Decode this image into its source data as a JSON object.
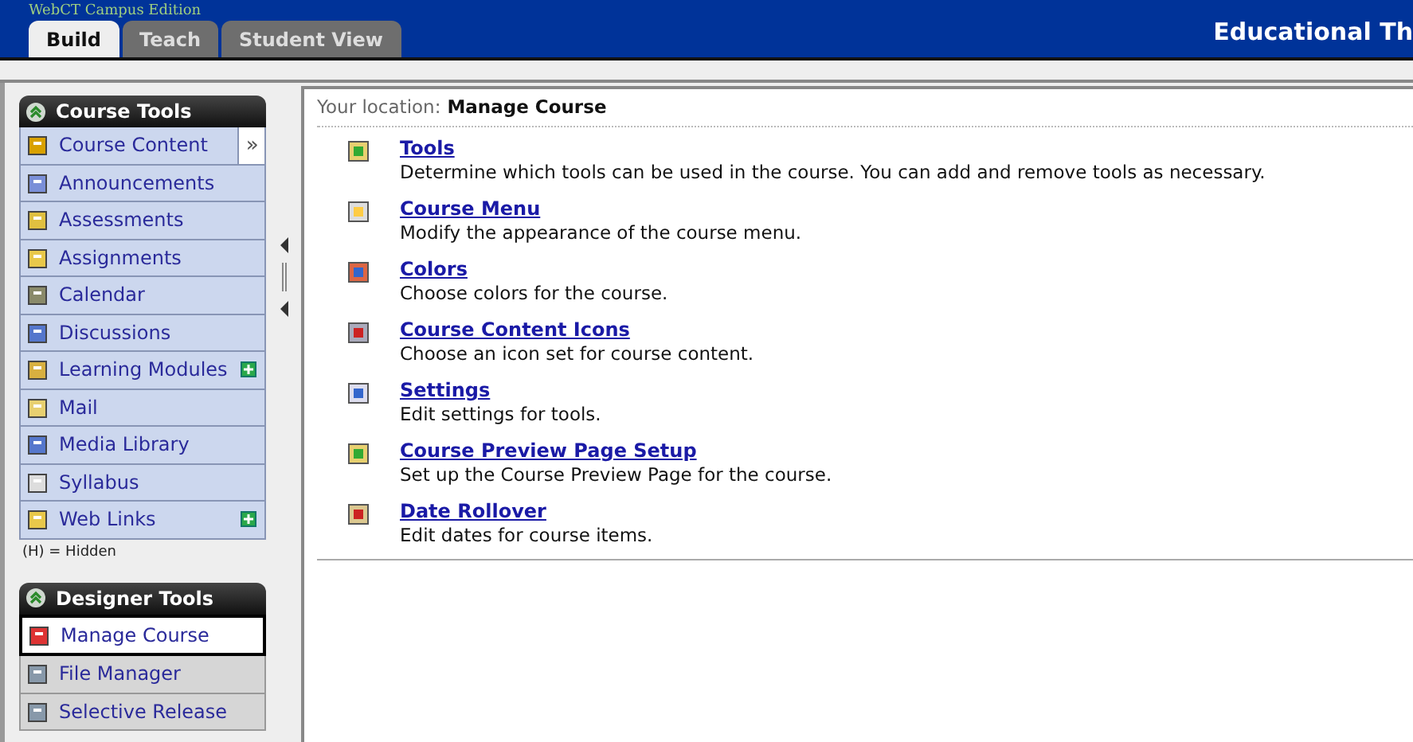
{
  "header": {
    "logo": "WebCT Campus Edition",
    "title": "Educational Th"
  },
  "tabs": [
    {
      "label": "Build",
      "selected": true
    },
    {
      "label": "Teach",
      "selected": false
    },
    {
      "label": "Student View",
      "selected": false
    }
  ],
  "sidebar": {
    "sections": [
      {
        "title": "Course Tools",
        "items": [
          {
            "label": "Course Content",
            "selected": false,
            "marked": false,
            "expander": "»"
          },
          {
            "label": "Announcements",
            "selected": false,
            "marked": false
          },
          {
            "label": "Assessments",
            "selected": false,
            "marked": false
          },
          {
            "label": "Assignments",
            "selected": false,
            "marked": false
          },
          {
            "label": "Calendar",
            "selected": false,
            "marked": false
          },
          {
            "label": "Discussions",
            "selected": false,
            "marked": false
          },
          {
            "label": "Learning Modules",
            "selected": false,
            "marked": true
          },
          {
            "label": "Mail",
            "selected": false,
            "marked": false
          },
          {
            "label": "Media Library",
            "selected": false,
            "marked": false
          },
          {
            "label": "Syllabus",
            "selected": false,
            "marked": false
          },
          {
            "label": "Web Links",
            "selected": false,
            "marked": true
          }
        ],
        "note": "(H) = Hidden"
      },
      {
        "title": "Designer Tools",
        "items": [
          {
            "label": "Manage Course",
            "selected": true,
            "marked": false
          },
          {
            "label": "File Manager",
            "selected": false,
            "marked": false
          },
          {
            "label": "Selective Release",
            "selected": false,
            "marked": false
          }
        ]
      }
    ]
  },
  "content": {
    "location_label": "Your location:",
    "location": "Manage Course",
    "entries": [
      {
        "title": "Tools",
        "description": "Determine which tools can be used in the course. You can add and remove tools as necessary."
      },
      {
        "title": "Course Menu",
        "description": "Modify the appearance of the course menu."
      },
      {
        "title": "Colors",
        "description": "Choose colors for the course."
      },
      {
        "title": "Course Content Icons",
        "description": "Choose an icon set for course content."
      },
      {
        "title": "Settings",
        "description": "Edit settings for tools."
      },
      {
        "title": "Course Preview Page Setup",
        "description": "Set up the Course Preview Page for the course."
      },
      {
        "title": "Date Rollover",
        "description": "Edit dates for course items."
      }
    ]
  }
}
